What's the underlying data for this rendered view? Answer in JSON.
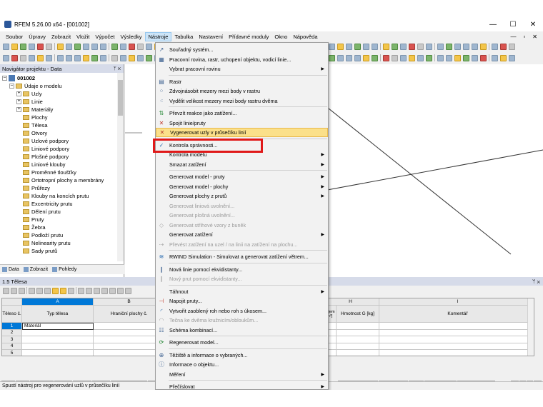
{
  "window": {
    "title": "RFEM 5.26.00 x64 - [001002]",
    "min": "—",
    "max": "☐",
    "close": "✕"
  },
  "menubar": {
    "items": [
      "Soubor",
      "Úpravy",
      "Zobrazit",
      "Vložit",
      "Výpočet",
      "Výsledky",
      "Nástroje",
      "Tabulka",
      "Nastavení",
      "Přídavné moduly",
      "Okno",
      "Nápověda"
    ],
    "active_index": 6,
    "right": [
      "—",
      "▫",
      "✕"
    ]
  },
  "navigator": {
    "title": "Navigátor projektu - Data",
    "pin": "ᛘ ✕",
    "tree": [
      {
        "label": "001002",
        "indent": 0,
        "type": "project",
        "exp": "–"
      },
      {
        "label": "Údaje o modelu",
        "indent": 1,
        "type": "folder",
        "exp": "–"
      },
      {
        "label": "Uzly",
        "indent": 2,
        "type": "folder",
        "exp": "+"
      },
      {
        "label": "Linie",
        "indent": 2,
        "type": "folder",
        "exp": "+"
      },
      {
        "label": "Materiály",
        "indent": 2,
        "type": "folder",
        "exp": "+"
      },
      {
        "label": "Plochy",
        "indent": 2,
        "type": "folder",
        "exp": ""
      },
      {
        "label": "Tělesa",
        "indent": 2,
        "type": "folder",
        "exp": ""
      },
      {
        "label": "Otvory",
        "indent": 2,
        "type": "folder",
        "exp": ""
      },
      {
        "label": "Uzlové podpory",
        "indent": 2,
        "type": "folder",
        "exp": ""
      },
      {
        "label": "Liniové podpory",
        "indent": 2,
        "type": "folder",
        "exp": ""
      },
      {
        "label": "Plošné podpory",
        "indent": 2,
        "type": "folder",
        "exp": ""
      },
      {
        "label": "Liniové klouby",
        "indent": 2,
        "type": "folder",
        "exp": ""
      },
      {
        "label": "Proměnné tloušťky",
        "indent": 2,
        "type": "folder",
        "exp": ""
      },
      {
        "label": "Ortotropní plochy a membrány",
        "indent": 2,
        "type": "folder",
        "exp": ""
      },
      {
        "label": "Průřezy",
        "indent": 2,
        "type": "folder",
        "exp": ""
      },
      {
        "label": "Klouby na koncích prutu",
        "indent": 2,
        "type": "folder",
        "exp": ""
      },
      {
        "label": "Excentricity prutu",
        "indent": 2,
        "type": "folder",
        "exp": ""
      },
      {
        "label": "Dělení prutu",
        "indent": 2,
        "type": "folder",
        "exp": ""
      },
      {
        "label": "Pruty",
        "indent": 2,
        "type": "folder",
        "exp": ""
      },
      {
        "label": "Žebra",
        "indent": 2,
        "type": "folder",
        "exp": ""
      },
      {
        "label": "Podloží prutu",
        "indent": 2,
        "type": "folder",
        "exp": ""
      },
      {
        "label": "Nelinearity prutu",
        "indent": 2,
        "type": "folder",
        "exp": ""
      },
      {
        "label": "Sady prutů",
        "indent": 2,
        "type": "folder",
        "exp": ""
      }
    ],
    "tabs": [
      "Data",
      "Zobrazit",
      "Pohledy"
    ]
  },
  "table": {
    "title": "1.5 Tělesa",
    "pin": "ᛘ ✕",
    "col_letters": [
      "A",
      "B",
      "H",
      "I"
    ],
    "headers": {
      "row": "Těleso č.",
      "a": "Typ tělesa",
      "b": "Hraniční plochy č.",
      "g": "Objem [m³]",
      "h": "Hmotnost G [kg]",
      "i": "Komentář"
    },
    "rows": [
      {
        "num": "1",
        "a": "Materiál"
      },
      {
        "num": "2",
        "a": ""
      },
      {
        "num": "3",
        "a": ""
      },
      {
        "num": "4",
        "a": ""
      },
      {
        "num": "5",
        "a": ""
      }
    ],
    "tabs_left": [
      "Uzly",
      "Linie",
      "Materiály",
      "Plochy",
      "Tělesa",
      "Otvory",
      "Uzlové podpory",
      "Linio"
    ],
    "tabs_right": [
      "Excentricity prutu",
      "Dělení prutu",
      "Pruty",
      "Podloží prutů",
      "Nelinearity prutu"
    ],
    "active_tab": "Tělesa",
    "nav": [
      "|◂",
      "◂",
      "▸",
      "▸|"
    ]
  },
  "status": "Spustí nástroj pro vegenerování uzlů v průsečíku linií",
  "menu": {
    "items": [
      {
        "label": "Souřadný systém...",
        "icon": "coordinate-icon",
        "disabled": false,
        "arrow": false
      },
      {
        "label": "Pracovní rovina, rastr, uchopení objektu, vodicí linie...",
        "icon": "grid-icon",
        "disabled": false,
        "arrow": false
      },
      {
        "label": "Vybrat pracovní rovinu",
        "icon": "",
        "disabled": false,
        "arrow": true
      },
      {
        "sep": true
      },
      {
        "label": "Rastr",
        "icon": "raster-icon",
        "disabled": false,
        "arrow": false
      },
      {
        "label": "Zdvojnásobit mezery mezi body v rastru",
        "icon": "double-icon",
        "disabled": false,
        "arrow": false
      },
      {
        "label": "Vydělit velikost mezery mezi body rastru dvěma",
        "icon": "divide-icon",
        "disabled": false,
        "arrow": false
      },
      {
        "sep": true
      },
      {
        "label": "Převzít reakce jako zatížení...",
        "icon": "reaction-icon",
        "disabled": false,
        "arrow": false
      },
      {
        "label": "Spojit linie/pruty",
        "icon": "join-icon",
        "disabled": false,
        "arrow": false
      },
      {
        "label": "Vygenerovat uzly v průsečíku linií",
        "icon": "intersect-icon",
        "disabled": false,
        "arrow": false,
        "highlight": true
      },
      {
        "sep": true
      },
      {
        "label": "Kontrola správnosti...",
        "icon": "check-icon",
        "disabled": false,
        "arrow": false
      },
      {
        "label": "Kontrola modelu",
        "icon": "",
        "disabled": false,
        "arrow": true
      },
      {
        "label": "Smazat zatížení",
        "icon": "",
        "disabled": false,
        "arrow": true
      },
      {
        "sep": true
      },
      {
        "label": "Generovat model - pruty",
        "icon": "",
        "disabled": false,
        "arrow": true
      },
      {
        "label": "Generovat model - plochy",
        "icon": "",
        "disabled": false,
        "arrow": true
      },
      {
        "label": "Generovat plochy z prutů",
        "icon": "",
        "disabled": false,
        "arrow": true
      },
      {
        "label": "Generovat liniová uvolnění...",
        "icon": "",
        "disabled": true,
        "arrow": false
      },
      {
        "label": "Generovat plošná uvolnění...",
        "icon": "",
        "disabled": true,
        "arrow": false
      },
      {
        "label": "Generovat střihové vzory z buněk",
        "icon": "pattern-icon",
        "disabled": true,
        "arrow": false
      },
      {
        "label": "Generovat zatížení",
        "icon": "",
        "disabled": false,
        "arrow": true
      },
      {
        "label": "Převést zatížení na uzel / na linii na zatížení na plochu...",
        "icon": "convert-icon",
        "disabled": true,
        "arrow": false
      },
      {
        "sep": true
      },
      {
        "label": "RWIND Simulation - Simulovat a generovat zatížení větrem...",
        "icon": "wind-icon",
        "disabled": false,
        "arrow": false
      },
      {
        "sep": true
      },
      {
        "label": "Nová linie pomocí ekvidistanty...",
        "icon": "equidistant-icon",
        "disabled": false,
        "arrow": false
      },
      {
        "label": "Nový prut pomocí ekvidistanty...",
        "icon": "equidistant-member-icon",
        "disabled": true,
        "arrow": false
      },
      {
        "sep": true
      },
      {
        "label": "Táhnout",
        "icon": "",
        "disabled": false,
        "arrow": true
      },
      {
        "label": "Napojit pruty...",
        "icon": "connect-icon",
        "disabled": false,
        "arrow": false
      },
      {
        "label": "Vytvořit zaoblený roh nebo roh s úkosem...",
        "icon": "fillet-icon",
        "disabled": false,
        "arrow": false
      },
      {
        "label": "Tečna ke dvěma kružnicím/obloukům...",
        "icon": "tangent-icon",
        "disabled": true,
        "arrow": false
      },
      {
        "label": "Schéma kombinací...",
        "icon": "scheme-icon",
        "disabled": false,
        "arrow": false
      },
      {
        "sep": true
      },
      {
        "label": "Regenerovat model...",
        "icon": "regenerate-icon",
        "disabled": false,
        "arrow": false
      },
      {
        "sep": true
      },
      {
        "label": "Těžiště a informace o vybraných...",
        "icon": "centroid-icon",
        "disabled": false,
        "arrow": false
      },
      {
        "label": "Informace o objektu...",
        "icon": "info-icon",
        "disabled": false,
        "arrow": false
      },
      {
        "label": "Měření",
        "icon": "",
        "disabled": false,
        "arrow": true
      },
      {
        "sep": true
      },
      {
        "label": "Přečíslovat",
        "icon": "",
        "disabled": false,
        "arrow": true
      }
    ]
  },
  "colors": {
    "highlight": "#fbe08a",
    "red_box": "#e01919",
    "selected_col": "#0078d7"
  }
}
